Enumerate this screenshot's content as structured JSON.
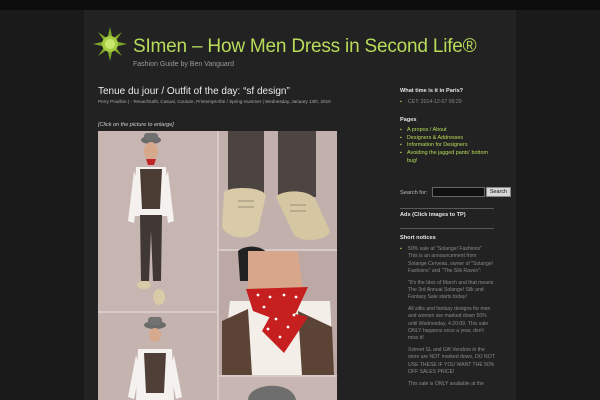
{
  "site": {
    "title": "SImen – How Men Dress in Second Life®",
    "subtitle": "Fashion Guide by Ben Vanguard"
  },
  "post": {
    "title": "Tenue du jour / Outfit of the day: “sf design”",
    "meta": "Perry Pouillon | - Tenue/Outfit, Casual, Couture, Printemps-Été / Spring-Summer | Wednesday, January 13th, 2010",
    "enlarge_note": "[Click on the picture to enlarge]"
  },
  "sidebar": {
    "time_heading": "What time is it in Paris?",
    "time_value": "CET: 2014-12-07 09:29",
    "pages_heading": "Pages",
    "pages": [
      "A propos / About",
      "Designers & Addresses",
      "Information for Designers",
      "Avoiding the jagged pants' bottom",
      "bug!"
    ],
    "search_label": "Search for:",
    "search_value": "",
    "search_button": "Search",
    "ads_heading": "Ads (Click images to TP)",
    "notices_heading": "Short notices",
    "notice_lines": [
      "50% sale at \"Solange! Fashions\"",
      "This is an announcement from",
      "Solange Cerveau, owner of \"Solange!",
      "Fashions\" and \"The Silk Raven\":",
      "",
      "\"It's the Ides of March and that means",
      "The 3rd Annual Solange! Silk and",
      "Fantasy Sale starts today!",
      "",
      "All silks and fantasy designs for men",
      "and women are marked down 50%",
      "until Wednesday, 4:20:09. This sale",
      "ONLY happens once a year, don't",
      "miss it!",
      "",
      "Xstreet SL and Gift Vendors in the",
      "store are NOT marked down, DO NOT",
      "USE THESE IF YOU WANT THE 50%",
      "OFF SALES PRICE!",
      "",
      "This sale is ONLY available at the"
    ]
  },
  "icons": {
    "logo": "green-starburst-logo",
    "bullet": "square-bullet"
  },
  "colors": {
    "accent_green": "#b8dc5a",
    "page_bg": "#222222",
    "outer_bg": "#1a1a1a"
  }
}
